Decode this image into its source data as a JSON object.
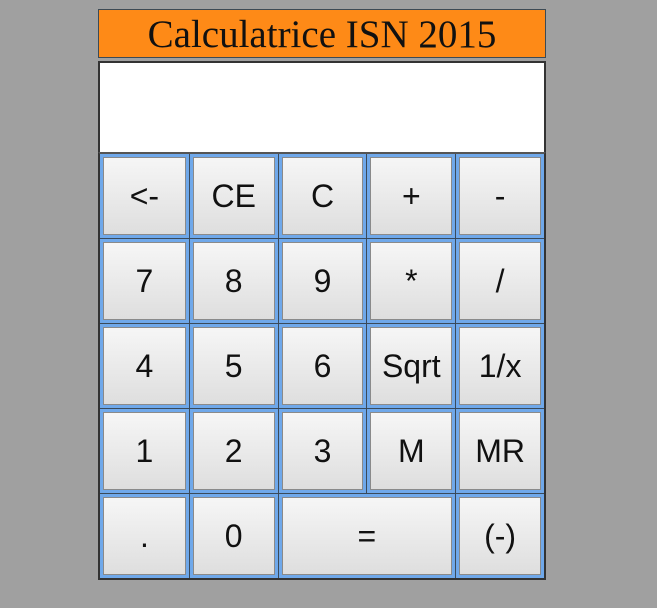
{
  "title": "Calculatrice ISN 2015",
  "display": {
    "value": ""
  },
  "keys": [
    [
      {
        "label": "<-",
        "name": "backspace-button"
      },
      {
        "label": "CE",
        "name": "clear-entry-button"
      },
      {
        "label": "C",
        "name": "clear-button"
      },
      {
        "label": "+",
        "name": "plus-button"
      },
      {
        "label": "-",
        "name": "minus-button"
      }
    ],
    [
      {
        "label": "7",
        "name": "digit-7-button"
      },
      {
        "label": "8",
        "name": "digit-8-button"
      },
      {
        "label": "9",
        "name": "digit-9-button"
      },
      {
        "label": "*",
        "name": "multiply-button"
      },
      {
        "label": "/",
        "name": "divide-button"
      }
    ],
    [
      {
        "label": "4",
        "name": "digit-4-button"
      },
      {
        "label": "5",
        "name": "digit-5-button"
      },
      {
        "label": "6",
        "name": "digit-6-button"
      },
      {
        "label": "Sqrt",
        "name": "sqrt-button"
      },
      {
        "label": "1/x",
        "name": "reciprocal-button"
      }
    ],
    [
      {
        "label": "1",
        "name": "digit-1-button"
      },
      {
        "label": "2",
        "name": "digit-2-button"
      },
      {
        "label": "3",
        "name": "digit-3-button"
      },
      {
        "label": "M",
        "name": "memory-store-button"
      },
      {
        "label": "MR",
        "name": "memory-recall-button"
      }
    ],
    [
      {
        "label": ".",
        "name": "decimal-point-button"
      },
      {
        "label": "0",
        "name": "digit-0-button"
      },
      {
        "label": "=",
        "name": "equals-button",
        "colspan": 2
      },
      {
        "label": "(-)",
        "name": "negate-button"
      }
    ]
  ],
  "colors": {
    "title_bg": "#fe8a17",
    "cell_bg": "#6fa8ea",
    "page_bg": "#a0a0a0"
  }
}
